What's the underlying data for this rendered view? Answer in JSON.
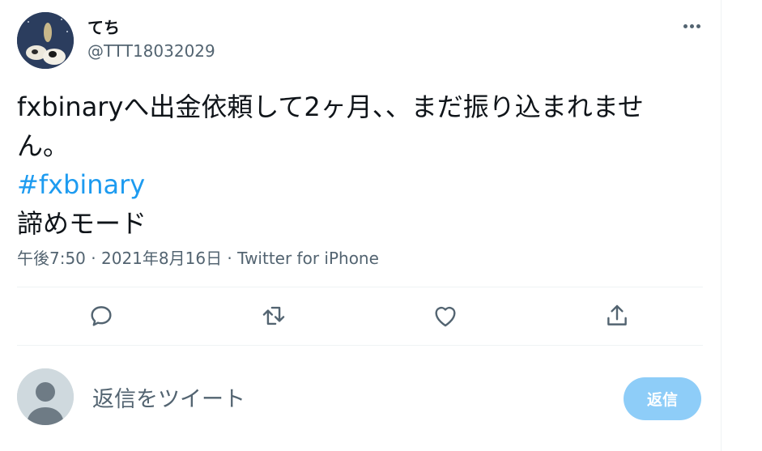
{
  "tweet": {
    "author": {
      "display_name": "てち",
      "handle": "@TTT18032029"
    },
    "text_line_1": "fxbinaryへ出金依頼して2ヶ月、、まだ振り込まれませ",
    "text_line_2": "ん。",
    "hashtag": "#fxbinary",
    "text_line_4": "諦めモード",
    "time": "午後7:50",
    "separator": " · ",
    "date": "2021年8月16日",
    "source": "Twitter for iPhone"
  },
  "actions": {
    "reply_icon": "reply-icon",
    "retweet_icon": "retweet-icon",
    "like_icon": "heart-icon",
    "share_icon": "share-icon"
  },
  "reply_box": {
    "placeholder": "返信をツイート",
    "button_label": "返信"
  },
  "colors": {
    "accent": "#1d9bf0",
    "button_disabled": "#8ecdf8",
    "secondary_text": "#536471",
    "divider": "#eff3f4"
  }
}
